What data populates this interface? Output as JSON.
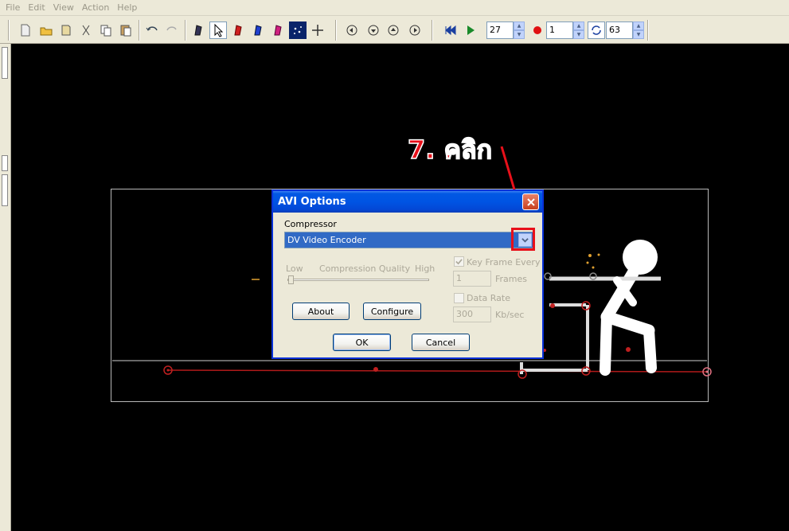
{
  "menu": [
    "File",
    "Edit",
    "View",
    "Action",
    "Help"
  ],
  "toolbar": {
    "frame_value": "27",
    "onion_value": "1",
    "fps_value": "63",
    "icons": [
      "new-file-icon",
      "open-folder-icon",
      "save-icon",
      "cut-icon",
      "copy-icon",
      "paste-icon",
      "undo-icon",
      "redo-icon",
      "edit-frame-icon",
      "select-arrow-icon",
      "red-figure-icon",
      "blue-figure-icon",
      "pink-figure-icon",
      "stage-icon",
      "move-icon",
      "rotate-left-icon",
      "flip-up-icon",
      "flip-down-icon",
      "rotate-right-icon",
      "rewind-icon",
      "play-icon",
      "record-icon",
      "loop-icon"
    ]
  },
  "annotation": {
    "text": "7. คลิก",
    "color": "#e8101a"
  },
  "dialog": {
    "title": "AVI Options",
    "compressor_label": "Compressor",
    "compressor_value": "DV Video Encoder",
    "low_label": "Low",
    "quality_label": "Compression Quality",
    "high_label": "High",
    "quality_level": 0,
    "key_frame_label": "Key Frame Every",
    "key_frame_checked": true,
    "key_frame_value": "1",
    "frames_label": "Frames",
    "data_rate_label": "Data Rate",
    "data_rate_checked": false,
    "data_rate_value": "300",
    "kbsec_label": "Kb/sec",
    "about_label": "About",
    "configure_label": "Configure",
    "ok_label": "OK",
    "cancel_label": "Cancel"
  },
  "colors": {
    "accent": "#316ac5",
    "titlebar": "#0054e3",
    "highlight": "#e8101a",
    "stage_bg": "#000000"
  }
}
